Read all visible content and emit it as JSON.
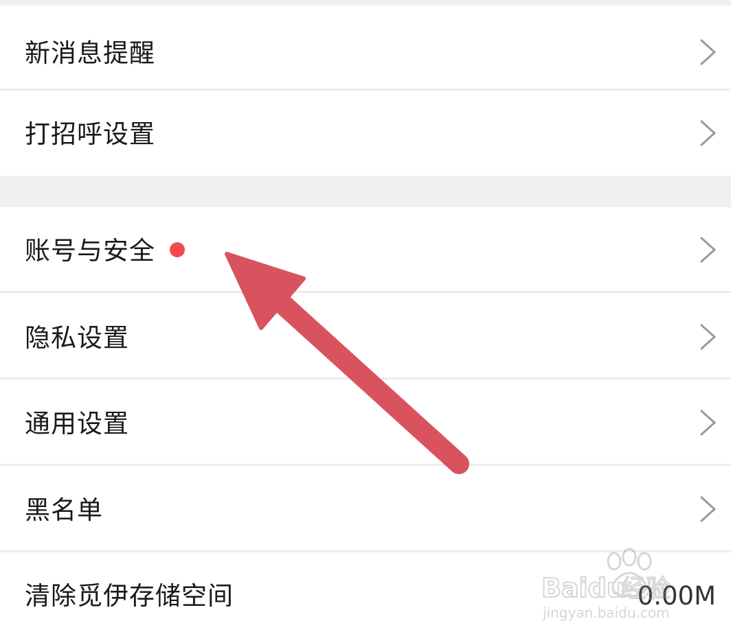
{
  "settings": {
    "items": [
      {
        "label": "新消息提醒"
      },
      {
        "label": "打招呼设置"
      },
      {
        "label": "账号与安全"
      },
      {
        "label": "隐私设置"
      },
      {
        "label": "通用设置"
      },
      {
        "label": "黑名单"
      },
      {
        "label": "清除觅伊存储空间",
        "value": "0.00M"
      }
    ]
  },
  "icons": {
    "chevron": "chevron-right-icon",
    "notification_dot": "red-dot-badge",
    "annotation": "arrow-annotation"
  },
  "colors": {
    "background": "#f0f0f0",
    "row": "#ffffff",
    "text": "#1a1a1a",
    "chevron": "#9a9a9a",
    "badge": "#f24a4f",
    "arrow": "#d9535e"
  },
  "watermark": {
    "brand": "Baidu经验",
    "url": "jingyan.baidu.com"
  }
}
